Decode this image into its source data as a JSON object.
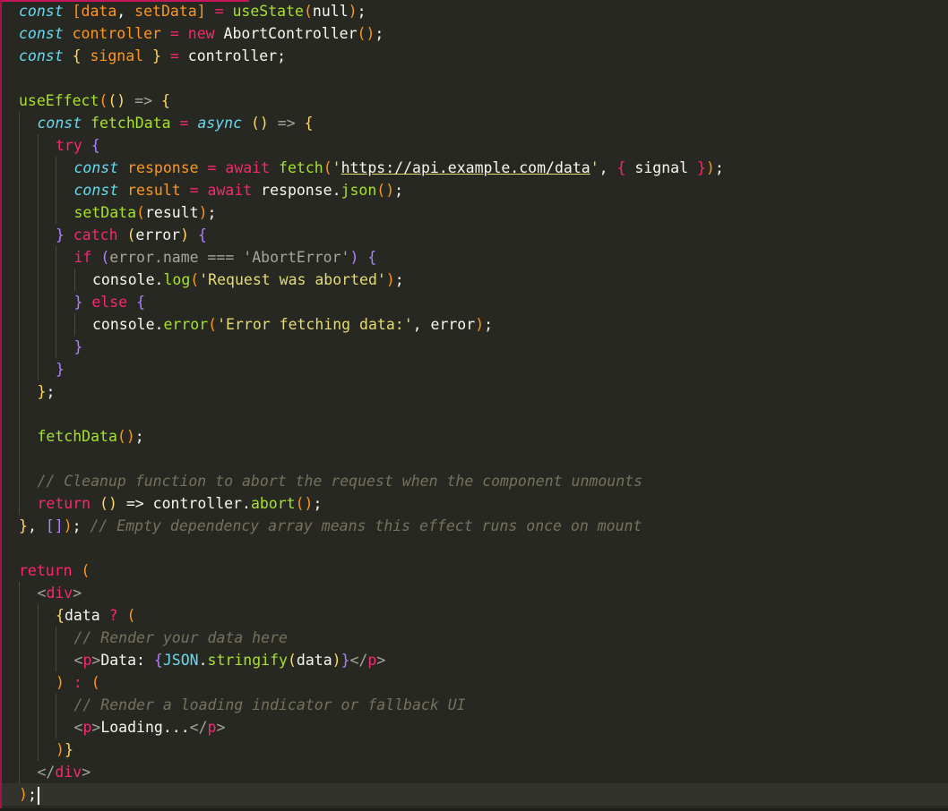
{
  "editor": {
    "theme_background": "#272822",
    "current_line": 35,
    "lines": [
      {
        "indent": 0,
        "tokens": [
          [
            "keyword",
            "const"
          ],
          [
            "plain",
            " "
          ],
          [
            "bracket",
            "["
          ],
          [
            "var",
            "data"
          ],
          [
            "plain",
            ", "
          ],
          [
            "var",
            "setData"
          ],
          [
            "bracket",
            "]"
          ],
          [
            "plain",
            " "
          ],
          [
            "op",
            "="
          ],
          [
            "plain",
            " "
          ],
          [
            "fn",
            "useState"
          ],
          [
            "bracket",
            "("
          ],
          [
            "plain",
            "null"
          ],
          [
            "bracket",
            ")"
          ],
          [
            "plain",
            ";"
          ]
        ]
      },
      {
        "indent": 0,
        "tokens": [
          [
            "keyword",
            "const"
          ],
          [
            "plain",
            " "
          ],
          [
            "var",
            "controller"
          ],
          [
            "plain",
            " "
          ],
          [
            "op",
            "="
          ],
          [
            "plain",
            " "
          ],
          [
            "control",
            "new"
          ],
          [
            "plain",
            " AbortController"
          ],
          [
            "bracket",
            "()"
          ],
          [
            "plain",
            ";"
          ]
        ]
      },
      {
        "indent": 0,
        "tokens": [
          [
            "keyword",
            "const"
          ],
          [
            "plain",
            " "
          ],
          [
            "brace",
            "{"
          ],
          [
            "plain",
            " "
          ],
          [
            "var",
            "signal"
          ],
          [
            "plain",
            " "
          ],
          [
            "brace",
            "}"
          ],
          [
            "plain",
            " "
          ],
          [
            "op",
            "="
          ],
          [
            "plain",
            " controller;"
          ]
        ]
      },
      {
        "indent": 0,
        "tokens": []
      },
      {
        "indent": 0,
        "tokens": [
          [
            "fn",
            "useEffect"
          ],
          [
            "bracket",
            "("
          ],
          [
            "brace",
            "()"
          ],
          [
            "plain",
            " "
          ],
          [
            "punct",
            "=>"
          ],
          [
            "plain",
            " "
          ],
          [
            "brace",
            "{"
          ]
        ]
      },
      {
        "indent": 1,
        "tokens": [
          [
            "keyword",
            "const"
          ],
          [
            "plain",
            " "
          ],
          [
            "fn",
            "fetchData"
          ],
          [
            "plain",
            " "
          ],
          [
            "op",
            "="
          ],
          [
            "plain",
            " "
          ],
          [
            "keyword",
            "async"
          ],
          [
            "plain",
            " "
          ],
          [
            "brace",
            "()"
          ],
          [
            "plain",
            " "
          ],
          [
            "punct",
            "=>"
          ],
          [
            "plain",
            " "
          ],
          [
            "brace",
            "{"
          ]
        ]
      },
      {
        "indent": 2,
        "tokens": [
          [
            "control",
            "try"
          ],
          [
            "plain",
            " "
          ],
          [
            "purple",
            "{"
          ]
        ]
      },
      {
        "indent": 3,
        "tokens": [
          [
            "keyword",
            "const"
          ],
          [
            "plain",
            " "
          ],
          [
            "var",
            "response"
          ],
          [
            "plain",
            " "
          ],
          [
            "op",
            "="
          ],
          [
            "plain",
            " "
          ],
          [
            "control",
            "await"
          ],
          [
            "plain",
            " "
          ],
          [
            "fn",
            "fetch"
          ],
          [
            "bracket",
            "("
          ],
          [
            "str",
            "'"
          ],
          [
            "url",
            "https://api.example.com/data"
          ],
          [
            "str",
            "'"
          ],
          [
            "plain",
            ", "
          ],
          [
            "control",
            "{"
          ],
          [
            "plain",
            " signal "
          ],
          [
            "control",
            "}"
          ],
          [
            "bracket",
            ")"
          ],
          [
            "plain",
            ";"
          ]
        ]
      },
      {
        "indent": 3,
        "tokens": [
          [
            "keyword",
            "const"
          ],
          [
            "plain",
            " "
          ],
          [
            "var",
            "result"
          ],
          [
            "plain",
            " "
          ],
          [
            "op",
            "="
          ],
          [
            "plain",
            " "
          ],
          [
            "control",
            "await"
          ],
          [
            "plain",
            " response."
          ],
          [
            "fn",
            "json"
          ],
          [
            "bracket",
            "()"
          ],
          [
            "plain",
            ";"
          ]
        ]
      },
      {
        "indent": 3,
        "tokens": [
          [
            "fn",
            "setData"
          ],
          [
            "bracket",
            "("
          ],
          [
            "plain",
            "result"
          ],
          [
            "bracket",
            ")"
          ],
          [
            "plain",
            ";"
          ]
        ]
      },
      {
        "indent": 2,
        "tokens": [
          [
            "purple",
            "}"
          ],
          [
            "plain",
            " "
          ],
          [
            "control",
            "catch"
          ],
          [
            "plain",
            " "
          ],
          [
            "brace",
            "("
          ],
          [
            "plain",
            "error"
          ],
          [
            "brace",
            ")"
          ],
          [
            "plain",
            " "
          ],
          [
            "purple",
            "{"
          ]
        ]
      },
      {
        "indent": 3,
        "tokens": [
          [
            "control",
            "if"
          ],
          [
            "plain",
            " "
          ],
          [
            "purple",
            "("
          ],
          [
            "punct",
            "error.name"
          ],
          [
            "plain",
            " "
          ],
          [
            "punct",
            "==="
          ],
          [
            "plain",
            " "
          ],
          [
            "punct",
            "'AbortError'"
          ],
          [
            "purple",
            ")"
          ],
          [
            "plain",
            " "
          ],
          [
            "purple",
            "{"
          ]
        ]
      },
      {
        "indent": 4,
        "tokens": [
          [
            "plain",
            "console."
          ],
          [
            "fn",
            "log"
          ],
          [
            "bracket",
            "("
          ],
          [
            "str",
            "'Request was aborted'"
          ],
          [
            "bracket",
            ")"
          ],
          [
            "plain",
            ";"
          ]
        ]
      },
      {
        "indent": 3,
        "tokens": [
          [
            "purple",
            "}"
          ],
          [
            "plain",
            " "
          ],
          [
            "control",
            "else"
          ],
          [
            "plain",
            " "
          ],
          [
            "purple",
            "{"
          ]
        ]
      },
      {
        "indent": 4,
        "tokens": [
          [
            "plain",
            "console."
          ],
          [
            "fn",
            "error"
          ],
          [
            "bracket",
            "("
          ],
          [
            "str",
            "'Error fetching data:'"
          ],
          [
            "plain",
            ", error"
          ],
          [
            "bracket",
            ")"
          ],
          [
            "plain",
            ";"
          ]
        ]
      },
      {
        "indent": 3,
        "tokens": [
          [
            "purple",
            "}"
          ]
        ]
      },
      {
        "indent": 2,
        "tokens": [
          [
            "purple",
            "}"
          ]
        ]
      },
      {
        "indent": 1,
        "tokens": [
          [
            "brace",
            "}"
          ],
          [
            "plain",
            ";"
          ]
        ]
      },
      {
        "indent": 1,
        "tokens": []
      },
      {
        "indent": 1,
        "tokens": [
          [
            "fn",
            "fetchData"
          ],
          [
            "bracket",
            "()"
          ],
          [
            "plain",
            ";"
          ]
        ]
      },
      {
        "indent": 1,
        "tokens": []
      },
      {
        "indent": 1,
        "tokens": [
          [
            "comment",
            "// Cleanup function to abort the request when the component unmounts"
          ]
        ]
      },
      {
        "indent": 1,
        "tokens": [
          [
            "control",
            "return"
          ],
          [
            "plain",
            " "
          ],
          [
            "brace",
            "()"
          ],
          [
            "plain",
            " => controller."
          ],
          [
            "fn",
            "abort"
          ],
          [
            "bracket",
            "()"
          ],
          [
            "plain",
            ";"
          ]
        ]
      },
      {
        "indent": 0,
        "tokens": [
          [
            "brace",
            "}"
          ],
          [
            "plain",
            ", "
          ],
          [
            "purple",
            "[]"
          ],
          [
            "bracket",
            ")"
          ],
          [
            "plain",
            "; "
          ],
          [
            "comment",
            "// Empty dependency array means this effect runs once on mount"
          ]
        ]
      },
      {
        "indent": 0,
        "tokens": []
      },
      {
        "indent": 0,
        "tokens": [
          [
            "control",
            "return"
          ],
          [
            "plain",
            " "
          ],
          [
            "bracket",
            "("
          ]
        ]
      },
      {
        "indent": 1,
        "tokens": [
          [
            "punct",
            "<"
          ],
          [
            "tag",
            "div"
          ],
          [
            "punct",
            ">"
          ]
        ]
      },
      {
        "indent": 2,
        "tokens": [
          [
            "brace",
            "{"
          ],
          [
            "plain",
            "data "
          ],
          [
            "op",
            "?"
          ],
          [
            "plain",
            " "
          ],
          [
            "bracket",
            "("
          ]
        ]
      },
      {
        "indent": 3,
        "tokens": [
          [
            "comment",
            "// Render your data here"
          ]
        ]
      },
      {
        "indent": 3,
        "tokens": [
          [
            "punct",
            "<"
          ],
          [
            "tag",
            "p"
          ],
          [
            "punct",
            ">"
          ],
          [
            "plain",
            "Data: "
          ],
          [
            "purple",
            "{"
          ],
          [
            "builtin",
            "JSON"
          ],
          [
            "plain",
            "."
          ],
          [
            "fn",
            "stringify"
          ],
          [
            "brace",
            "("
          ],
          [
            "plain",
            "data"
          ],
          [
            "brace",
            ")"
          ],
          [
            "purple",
            "}"
          ],
          [
            "punct",
            "</"
          ],
          [
            "tag",
            "p"
          ],
          [
            "punct",
            ">"
          ]
        ]
      },
      {
        "indent": 2,
        "tokens": [
          [
            "bracket",
            ")"
          ],
          [
            "plain",
            " "
          ],
          [
            "op",
            ":"
          ],
          [
            "plain",
            " "
          ],
          [
            "bracket",
            "("
          ]
        ]
      },
      {
        "indent": 3,
        "tokens": [
          [
            "comment",
            "// Render a loading indicator or fallback UI"
          ]
        ]
      },
      {
        "indent": 3,
        "tokens": [
          [
            "punct",
            "<"
          ],
          [
            "tag",
            "p"
          ],
          [
            "punct",
            ">"
          ],
          [
            "plain",
            "Loading..."
          ],
          [
            "punct",
            "</"
          ],
          [
            "tag",
            "p"
          ],
          [
            "punct",
            ">"
          ]
        ]
      },
      {
        "indent": 2,
        "tokens": [
          [
            "bracket",
            ")"
          ],
          [
            "brace",
            "}"
          ]
        ]
      },
      {
        "indent": 1,
        "tokens": [
          [
            "punct",
            "</"
          ],
          [
            "tag",
            "div"
          ],
          [
            "punct",
            ">"
          ]
        ]
      },
      {
        "indent": 0,
        "tokens": [
          [
            "bracket",
            ")"
          ],
          [
            "plain",
            ";"
          ]
        ]
      }
    ]
  }
}
